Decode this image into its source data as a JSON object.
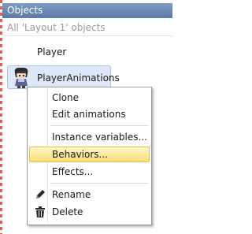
{
  "panel": {
    "title": "Objects",
    "subtitle": "All 'Layout 1' objects",
    "objects": [
      {
        "name": "Player"
      },
      {
        "name": "PlayerAnimations",
        "selected": true,
        "icon": "character-sprite-icon"
      }
    ]
  },
  "context_menu": {
    "items": [
      {
        "label": "Clone"
      },
      {
        "label": "Edit animations"
      },
      {
        "label": "Instance variables..."
      },
      {
        "label": "Behaviors...",
        "highlighted": true
      },
      {
        "label": "Effects..."
      },
      {
        "label": "Rename",
        "icon": "pencil-icon"
      },
      {
        "label": "Delete",
        "icon": "trash-icon"
      }
    ]
  },
  "colors": {
    "header_bg": "#6b89b3",
    "selection_bg": "#dde9f8",
    "highlight_bg": "#f9e7a0"
  }
}
